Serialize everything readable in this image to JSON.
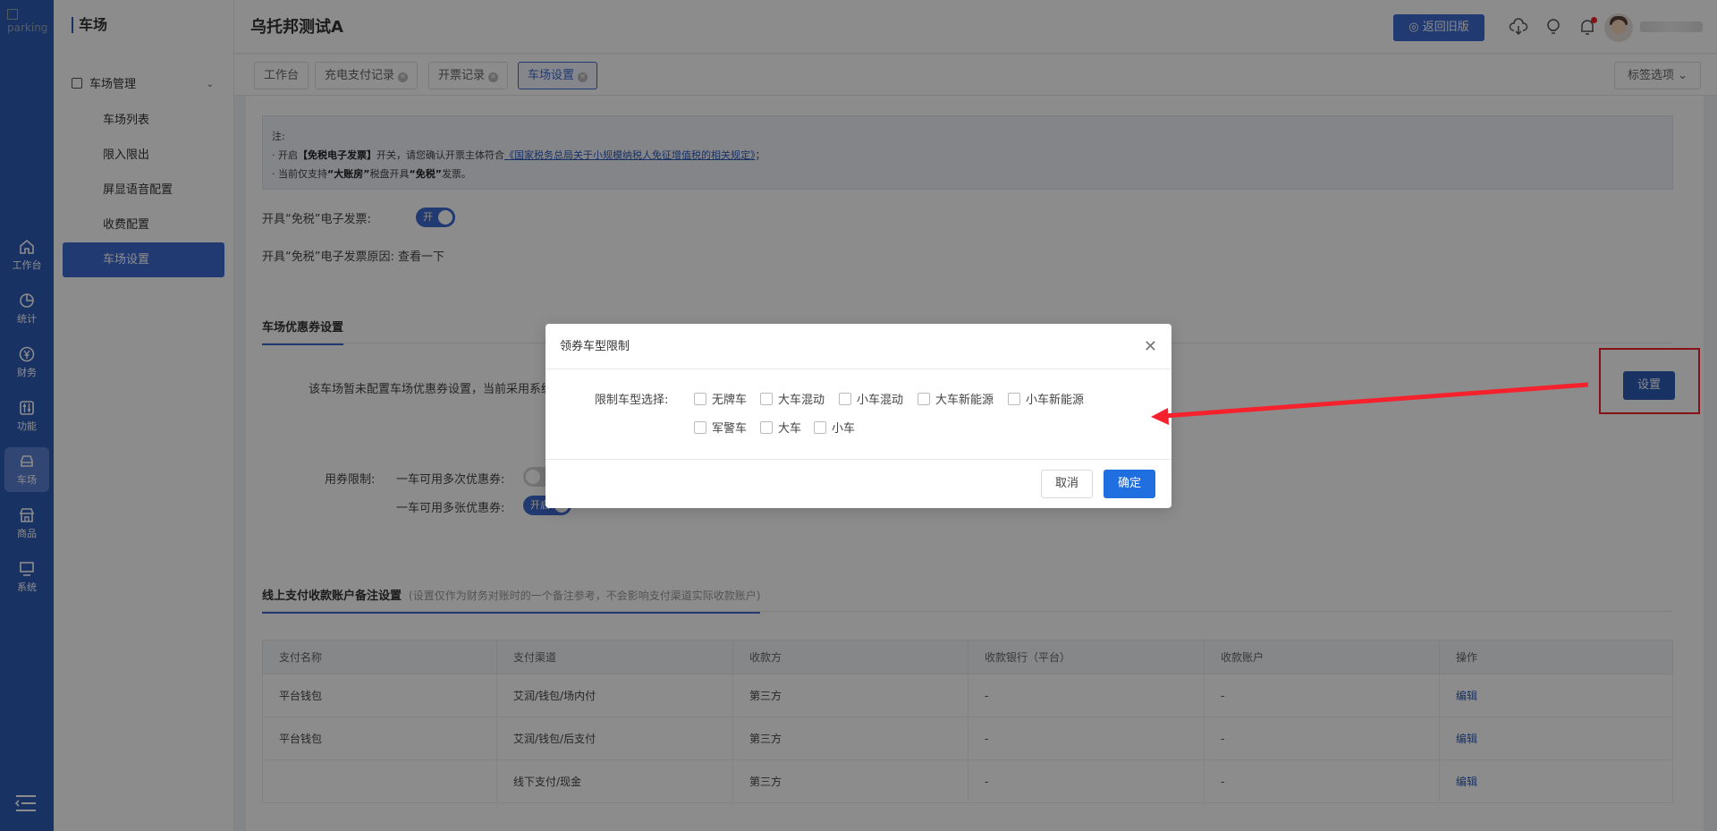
{
  "rail": {
    "logo_alt": "parking",
    "items": [
      {
        "label": "工作台",
        "icon": "home-icon"
      },
      {
        "label": "统计",
        "icon": "pie-chart-icon"
      },
      {
        "label": "财务",
        "icon": "yen-icon"
      },
      {
        "label": "功能",
        "icon": "sliders-icon"
      },
      {
        "label": "车场",
        "icon": "car-icon"
      },
      {
        "label": "商品",
        "icon": "store-icon"
      },
      {
        "label": "系统",
        "icon": "monitor-icon"
      }
    ]
  },
  "submenu": {
    "title": "车场",
    "group": "车场管理",
    "items": [
      {
        "label": "车场列表"
      },
      {
        "label": "限入限出"
      },
      {
        "label": "屏显语音配置"
      },
      {
        "label": "收费配置"
      },
      {
        "label": "车场设置"
      }
    ]
  },
  "header": {
    "org_name": "乌托邦测试A",
    "back_old_label": "返回旧版"
  },
  "tabs": {
    "items": [
      {
        "label": "工作台"
      },
      {
        "label": "充电支付记录"
      },
      {
        "label": "开票记录"
      },
      {
        "label": "车场设置"
      }
    ],
    "options_label": "标签选项"
  },
  "notice": {
    "title": "注:",
    "line1_prefix": "· 开启",
    "line1_bold": "【免税电子发票】",
    "line1_mid": "开关，请您确认开票主体符合",
    "line1_link": "《国家税务总局关于小规模纳税人免征增值税的相关规定》",
    "line1_suffix": "；",
    "line2_prefix": "· 当前仅支持",
    "line2_bold1": "“大账房”",
    "line2_mid": "税盘开具",
    "line2_bold2": "“免税”",
    "line2_suffix": "发票。"
  },
  "invoice": {
    "toggle_label": "开具“免税”电子发票:",
    "toggle_state": "开",
    "reason_label": "开具“免税”电子发票原因:",
    "reason_value": "查看一下"
  },
  "coupon": {
    "section_title": "车场优惠券设置",
    "description": "该车场暂未配置车场优惠券设置，当前采用系统",
    "set_button": "设置",
    "limit_label": "用券限制:",
    "multi_times_label": "一车可用多次优惠券:",
    "multi_sheets_label": "一车可用多张优惠券:",
    "multi_sheets_state": "开启"
  },
  "payment": {
    "section_title": "线上支付收款账户备注设置",
    "section_note": "(设置仅作为财务对账时的一个备注参考，不会影响支付渠道实际收款账户)",
    "columns": [
      "支付名称",
      "支付渠道",
      "收款方",
      "收款银行（平台）",
      "收款账户",
      "操作"
    ],
    "rows": [
      [
        "平台钱包",
        "艾润/钱包/场内付",
        "第三方",
        "-",
        "-",
        "编辑"
      ],
      [
        "平台钱包",
        "艾润/钱包/后支付",
        "第三方",
        "-",
        "-",
        "编辑"
      ],
      [
        "",
        "线下支付/现金",
        "第三方",
        "-",
        "-",
        "编辑"
      ]
    ]
  },
  "modal": {
    "title": "领券车型限制",
    "field_label": "限制车型选择:",
    "options": [
      "无牌车",
      "大车混动",
      "小车混动",
      "大车新能源",
      "小车新能源",
      "军警车",
      "大车",
      "小车"
    ],
    "cancel_label": "取消",
    "ok_label": "确定"
  },
  "colors": {
    "primary": "#3e6bd0",
    "rail": "#2f5bb7",
    "annotation": "#f5222d"
  }
}
